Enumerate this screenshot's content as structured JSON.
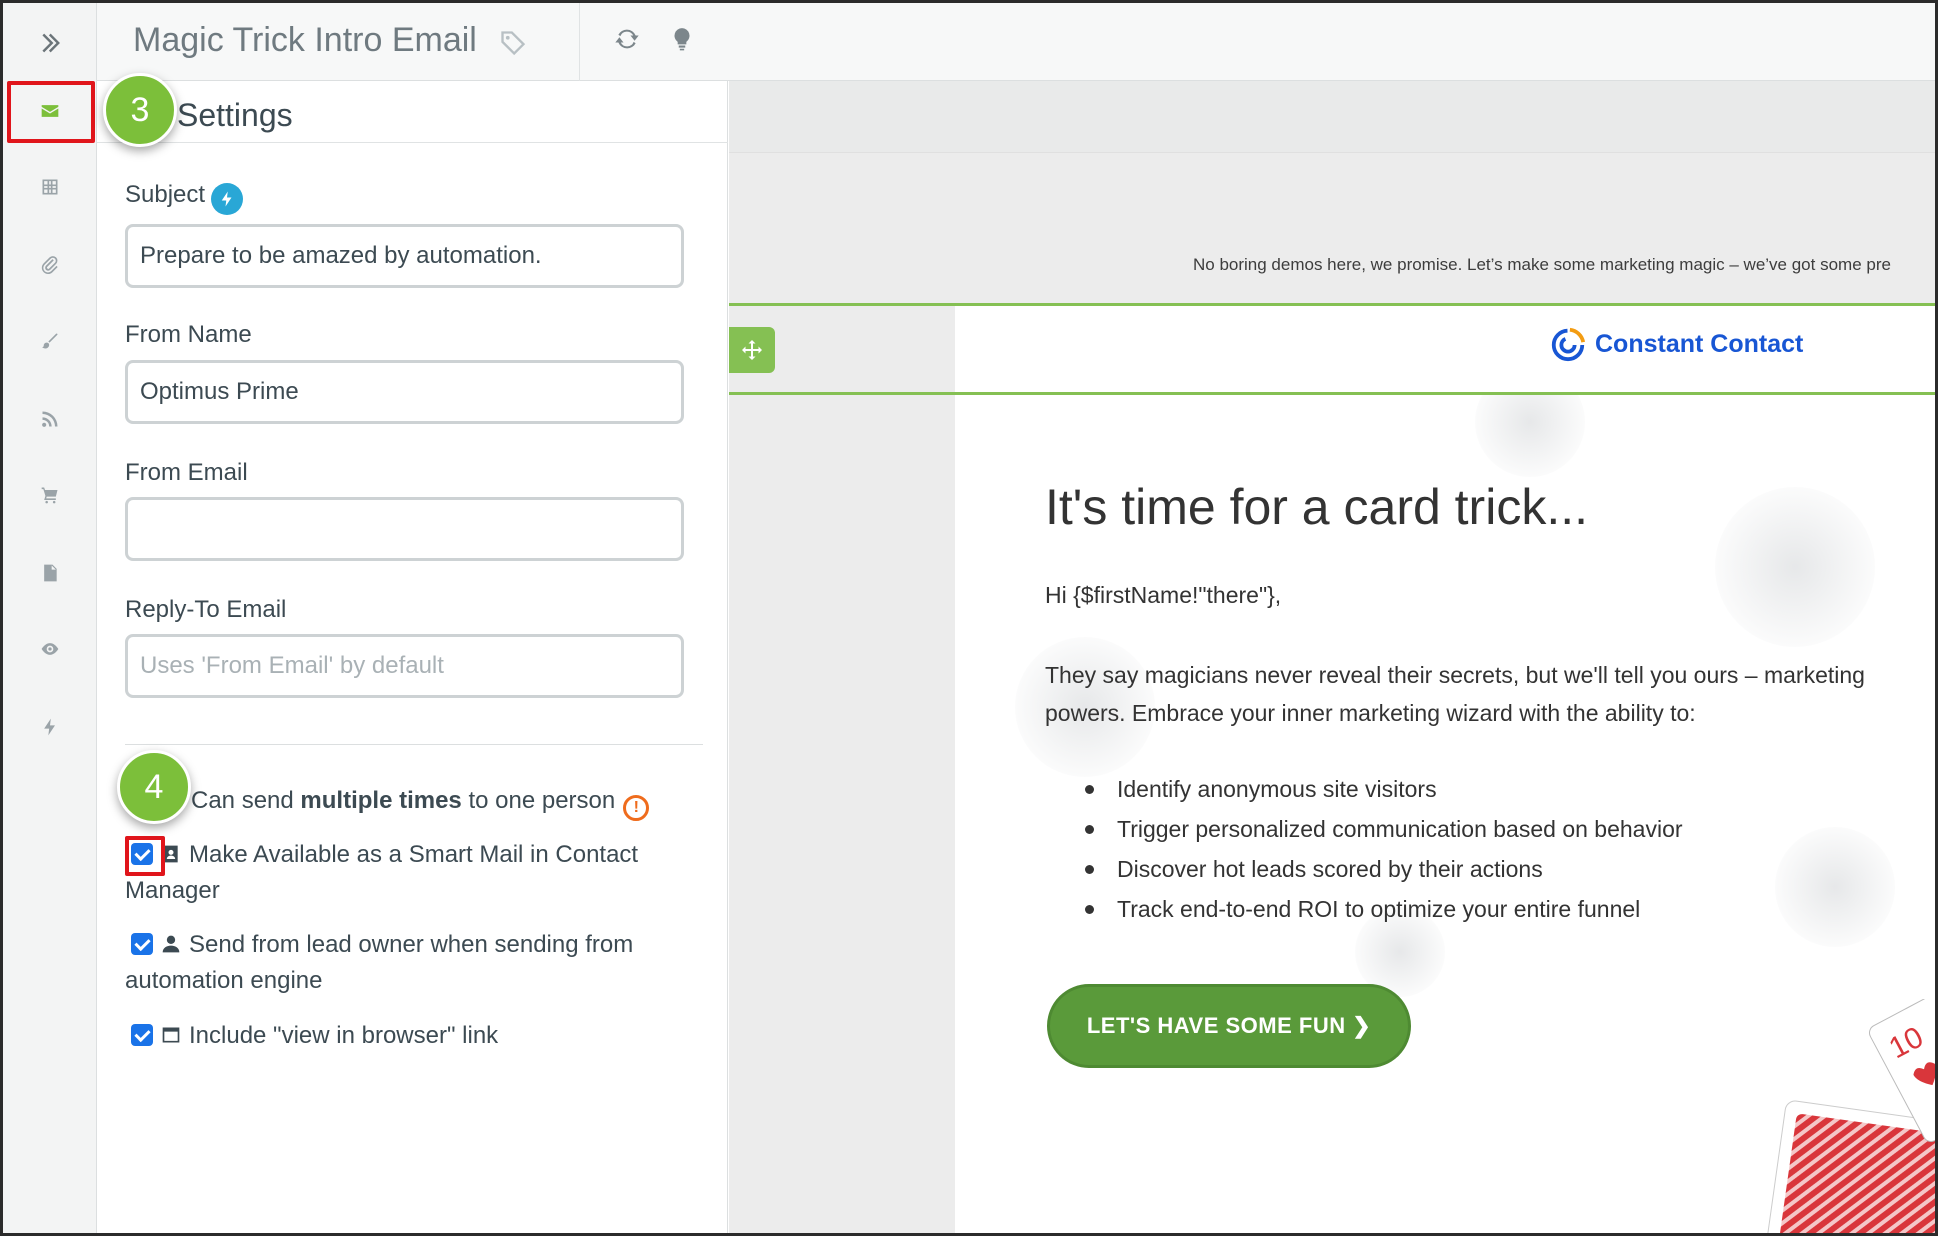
{
  "header": {
    "title": "Magic Trick Intro Email"
  },
  "rail": {
    "items": [
      {
        "icon": "chevron-double-right-icon"
      },
      {
        "icon": "envelope-icon",
        "active": true
      },
      {
        "icon": "grid-icon"
      },
      {
        "icon": "paperclip-icon"
      },
      {
        "icon": "paintbrush-icon"
      },
      {
        "icon": "rss-icon"
      },
      {
        "icon": "cart-icon"
      },
      {
        "icon": "document-icon"
      },
      {
        "icon": "eye-icon"
      },
      {
        "icon": "bolt-icon"
      }
    ]
  },
  "panel": {
    "title": "l Settings",
    "subject_label": "Subject",
    "subject_value": "Prepare to be amazed by automation.",
    "from_name_label": "From Name",
    "from_name_value": "Optimus Prime",
    "from_email_label": "From Email",
    "from_email_value": "",
    "reply_to_label": "Reply-To Email",
    "reply_to_placeholder": "Uses 'From Email' by default",
    "options": {
      "multiple_prefix": "Can send ",
      "multiple_bold": "multiple times",
      "multiple_suffix": " to one person",
      "smart_mail": "Make Available as a Smart Mail in Contact Manager",
      "lead_owner": "Send from lead owner when sending from automation engine",
      "view_browser": "Include \"view in browser\" link"
    }
  },
  "steps": {
    "step3": "3",
    "step4": "4"
  },
  "preview": {
    "preheader": "No boring demos here, we promise. Let’s make some marketing magic – we’ve got some pre",
    "logo_text": "Constant Contact",
    "headline": "It's time for a card trick...",
    "greeting": "Hi {$firstName!\"there\"},",
    "intro_line1": "They say magicians never reveal their secrets, but we'll tell you ours – marketing",
    "intro_line2": "powers. Embrace your inner marketing wizard with the ability to:",
    "bullets": [
      "Identify anonymous site visitors",
      "Trigger personalized communication based on behavior",
      "Discover hot leads scored by their actions",
      "Track end-to-end ROI to optimize your entire funnel"
    ],
    "cta": "LET'S HAVE SOME FUN ❯",
    "card_rank": "10"
  },
  "colors": {
    "accent_green": "#7cbf3a",
    "cta_green": "#5a9a3a",
    "highlight_red": "#e0151b",
    "brand_blue": "#1856d4",
    "warn_orange": "#ef6c1d",
    "info_blue": "#29a7d6"
  }
}
